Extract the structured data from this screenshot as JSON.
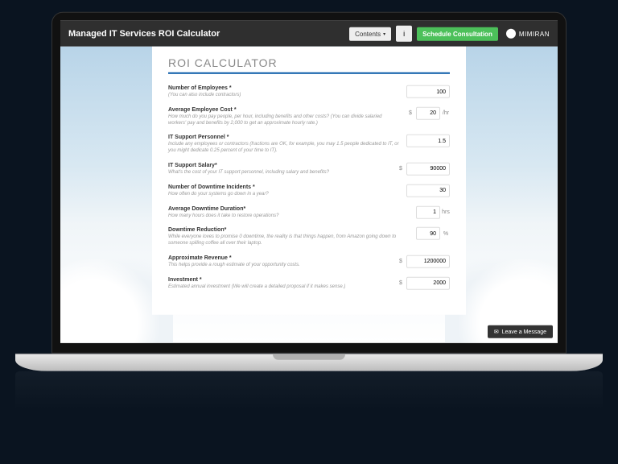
{
  "header": {
    "title": "Managed IT Services ROI Calculator",
    "contents_label": "Contents",
    "info_icon": "i",
    "schedule_label": "Schedule Consultation",
    "brand": "MIMIRAN"
  },
  "form": {
    "title": "ROI CALCULATOR",
    "rows": [
      {
        "label": "Number of Employees *",
        "help": "(You can also include contractors)",
        "value": "100",
        "prefix": "",
        "suffix": "",
        "width": "lg"
      },
      {
        "label": "Average Employee Cost *",
        "help": "How much do you pay people, per hour, including benefits and other costs? (You can divide salaried workers' pay and benefits by 2,000 to get an approximate hourly rate.)",
        "value": "20",
        "prefix": "$",
        "suffix": "/hr",
        "width": "sm"
      },
      {
        "label": "IT Support Personnel *",
        "help": "Include any employees or contractors (fractions are OK, for example, you may 1.5 people dedicated to IT, or you might dedicate 0.25 percent of your time to IT).",
        "value": "1.5",
        "prefix": "",
        "suffix": "",
        "width": "lg"
      },
      {
        "label": "IT Support Salary*",
        "help": "What's the cost of your IT support personnel, including salary and benefits?",
        "value": "90000",
        "prefix": "$",
        "suffix": "",
        "width": "lg"
      },
      {
        "label": "Number of Downtime Incidents *",
        "help": "How often do your systems go down in a year?",
        "value": "30",
        "prefix": "",
        "suffix": "",
        "width": "lg"
      },
      {
        "label": "Average Downtime Duration*",
        "help": "How many hours does it take to restore operations?",
        "value": "1",
        "prefix": "",
        "suffix": "hrs",
        "width": "sm"
      },
      {
        "label": "Downtime Reduction*",
        "help": "While everyone loves to promise 0 downtime, the reality is that things happen, from Amazon going down to someone spilling coffee all over their laptop.",
        "value": "90",
        "prefix": "",
        "suffix": "%",
        "width": "sm"
      },
      {
        "label": "Approximate Revenue *",
        "help": "This helps provide a rough estimate of your opportunity costs.",
        "value": "1200000",
        "prefix": "$",
        "suffix": "",
        "width": "lg"
      },
      {
        "label": "Investment *",
        "help": "Estimated annual investment (We will create a detailed proposal if it makes sense.)",
        "value": "2000",
        "prefix": "$",
        "suffix": "",
        "width": "lg"
      }
    ]
  },
  "leave_message": "Leave a Message"
}
